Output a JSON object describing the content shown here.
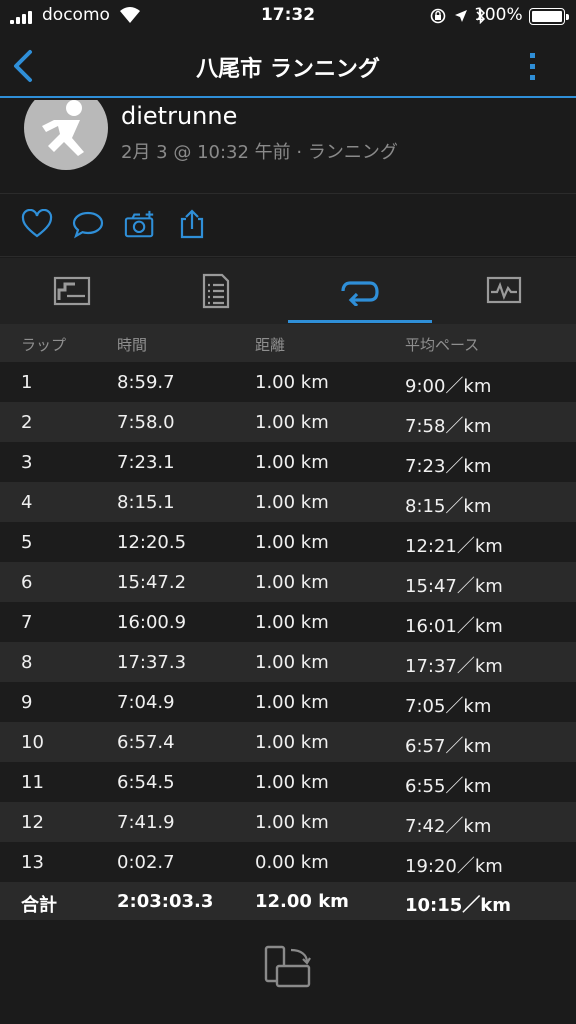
{
  "status_bar": {
    "carrier": "docomo",
    "time": "17:32",
    "battery": "100%"
  },
  "nav": {
    "title": "八尾市 ランニング"
  },
  "profile": {
    "username": "dietrunne",
    "meta": "2月 3 @ 10:32 午前 · ランニング"
  },
  "icons": {
    "like": "heart-icon",
    "comment": "speech-bubble-icon",
    "photo": "camera-plus-icon",
    "share": "share-icon",
    "tab1": "summary-chart-icon",
    "tab2": "details-document-icon",
    "tab3": "laps-loop-icon",
    "tab4": "graph-icon",
    "rotate": "rotate-device-icon"
  },
  "colors": {
    "accent": "#2f8fd8",
    "background": "#1b1b1b"
  },
  "laps": {
    "headers": [
      "ラップ",
      "時間",
      "距離",
      "平均ペース"
    ],
    "rows": [
      [
        "1",
        "8:59.7",
        "1.00 km",
        "9:00／km"
      ],
      [
        "2",
        "7:58.0",
        "1.00 km",
        "7:58／km"
      ],
      [
        "3",
        "7:23.1",
        "1.00 km",
        "7:23／km"
      ],
      [
        "4",
        "8:15.1",
        "1.00 km",
        "8:15／km"
      ],
      [
        "5",
        "12:20.5",
        "1.00 km",
        "12:21／km"
      ],
      [
        "6",
        "15:47.2",
        "1.00 km",
        "15:47／km"
      ],
      [
        "7",
        "16:00.9",
        "1.00 km",
        "16:01／km"
      ],
      [
        "8",
        "17:37.3",
        "1.00 km",
        "17:37／km"
      ],
      [
        "9",
        "7:04.9",
        "1.00 km",
        "7:05／km"
      ],
      [
        "10",
        "6:57.4",
        "1.00 km",
        "6:57／km"
      ],
      [
        "11",
        "6:54.5",
        "1.00 km",
        "6:55／km"
      ],
      [
        "12",
        "7:41.9",
        "1.00 km",
        "7:42／km"
      ],
      [
        "13",
        "0:02.7",
        "0.00 km",
        "19:20／km"
      ]
    ],
    "total": [
      "合計",
      "2:03:03.3",
      "12.00 km",
      "10:15／km"
    ]
  }
}
